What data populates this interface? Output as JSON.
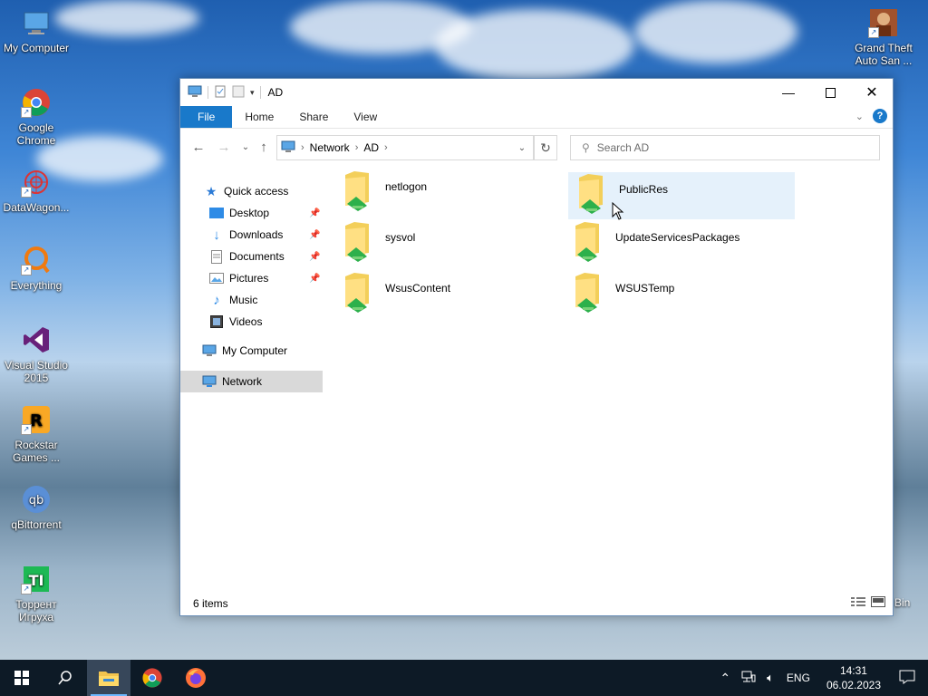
{
  "desktop": {
    "icons": [
      {
        "label": "My Computer"
      },
      {
        "label": "Google Chrome"
      },
      {
        "label": "DataWagon..."
      },
      {
        "label": "Everything"
      },
      {
        "label": "Visual Studio 2015"
      },
      {
        "label": "Rockstar Games ..."
      },
      {
        "label": "qBittorrent"
      },
      {
        "label": "Торрент Игруха"
      },
      {
        "label": "Grand Theft Auto San ..."
      }
    ],
    "recycle_label": "Bin"
  },
  "window": {
    "title": "AD",
    "ribbon_tabs": [
      "File",
      "Home",
      "Share",
      "View"
    ],
    "address": {
      "crumbs": [
        "Network",
        "AD"
      ]
    },
    "search_placeholder": "Search AD",
    "sidebar": {
      "quick_access": "Quick access",
      "items": [
        "Desktop",
        "Downloads",
        "Documents",
        "Pictures",
        "Music",
        "Videos"
      ],
      "my_computer": "My Computer",
      "network": "Network"
    },
    "folders": [
      "netlogon",
      "PublicRes",
      "sysvol",
      "UpdateServicesPackages",
      "WsusContent",
      "WSUSTemp"
    ],
    "status": "6 items"
  },
  "taskbar": {
    "lang": "ENG",
    "time": "14:31",
    "date": "06.02.2023"
  },
  "colors": {
    "accent": "#1979ca",
    "taskbar": "#0d1a26"
  }
}
